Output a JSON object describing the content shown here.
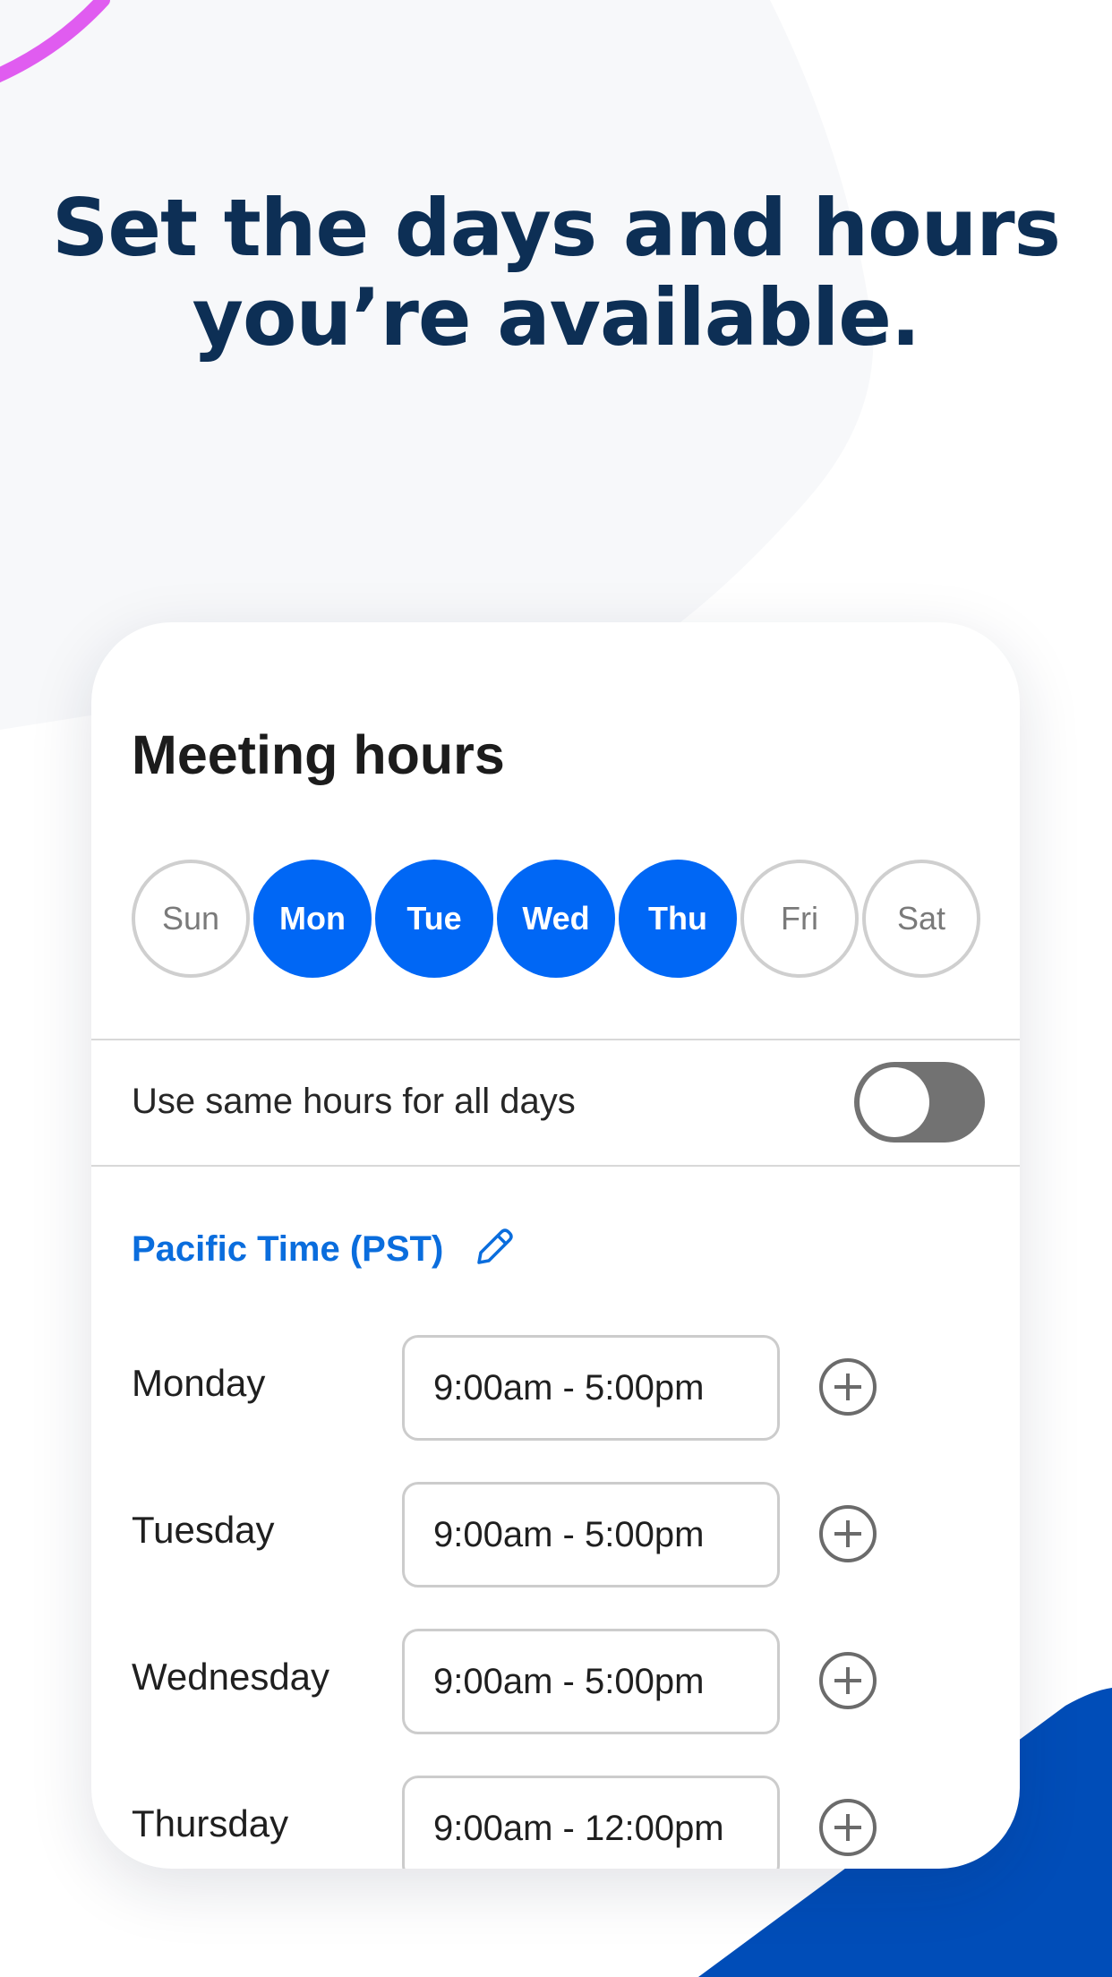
{
  "headline": {
    "line1": "Set the days and hours",
    "line2": "you’re available."
  },
  "card": {
    "title": "Meeting hours",
    "days": [
      {
        "label": "Sun",
        "selected": false
      },
      {
        "label": "Mon",
        "selected": true
      },
      {
        "label": "Tue",
        "selected": true
      },
      {
        "label": "Wed",
        "selected": true
      },
      {
        "label": "Thu",
        "selected": true
      },
      {
        "label": "Fri",
        "selected": false
      },
      {
        "label": "Sat",
        "selected": false
      }
    ],
    "same_hours": {
      "label": "Use same hours for all days",
      "enabled": false
    },
    "timezone": {
      "label": "Pacific Time (PST)",
      "icon": "pencil-edit-icon"
    },
    "schedule": [
      {
        "day": "Monday",
        "hours": "9:00am - 5:00pm"
      },
      {
        "day": "Tuesday",
        "hours": "9:00am - 5:00pm"
      },
      {
        "day": "Wednesday",
        "hours": "9:00am - 5:00pm"
      },
      {
        "day": "Thursday",
        "hours": "9:00am - 12:00pm"
      }
    ],
    "add_icon": "plus-circle-icon"
  },
  "colors": {
    "accent": "#0067f5",
    "timezone_text": "#0a6ddd",
    "headline": "#0d2f55",
    "decor_blue": "#004db8",
    "decor_pink": "#e05cf0",
    "toggle_off": "#727272"
  }
}
